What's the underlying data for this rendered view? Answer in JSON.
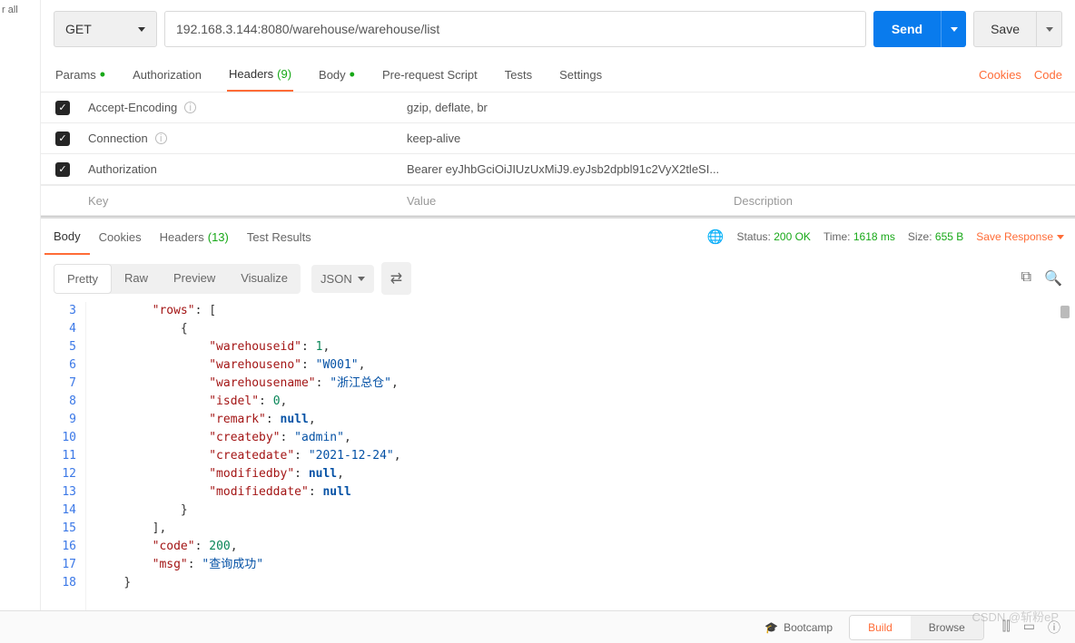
{
  "leftStrip": "r all",
  "request": {
    "method": "GET",
    "url": "192.168.3.144:8080/warehouse/warehouse/list",
    "sendLabel": "Send",
    "saveLabel": "Save"
  },
  "reqTabs": {
    "params": "Params",
    "authorization": "Authorization",
    "headers": "Headers",
    "headersCount": "(9)",
    "body": "Body",
    "preRequest": "Pre-request Script",
    "tests": "Tests",
    "settings": "Settings",
    "cookies": "Cookies",
    "code": "Code"
  },
  "headers": [
    {
      "key": "Accept-Encoding",
      "value": "gzip, deflate, br",
      "info": true
    },
    {
      "key": "Connection",
      "value": "keep-alive",
      "info": true
    },
    {
      "key": "Authorization",
      "value": "Bearer eyJhbGciOiJIUzUxMiJ9.eyJsb2dpbl91c2VyX2tleSI...",
      "info": false
    }
  ],
  "headerPlaceholders": {
    "key": "Key",
    "value": "Value",
    "description": "Description"
  },
  "respTabs": {
    "body": "Body",
    "cookies": "Cookies",
    "headers": "Headers",
    "headersCount": "(13)",
    "testResults": "Test Results"
  },
  "respMeta": {
    "statusLabel": "Status:",
    "statusValue": "200 OK",
    "timeLabel": "Time:",
    "timeValue": "1618 ms",
    "sizeLabel": "Size:",
    "sizeValue": "655 B",
    "saveResponse": "Save Response"
  },
  "formatBar": {
    "pretty": "Pretty",
    "raw": "Raw",
    "preview": "Preview",
    "visualize": "Visualize",
    "json": "JSON"
  },
  "codeLines": [
    {
      "num": "3",
      "indent": 2,
      "parts": [
        {
          "t": "key",
          "v": "\"rows\""
        },
        {
          "t": "punc",
          "v": ": ["
        }
      ]
    },
    {
      "num": "4",
      "indent": 3,
      "parts": [
        {
          "t": "punc",
          "v": "{"
        }
      ]
    },
    {
      "num": "5",
      "indent": 4,
      "parts": [
        {
          "t": "key",
          "v": "\"warehouseid\""
        },
        {
          "t": "punc",
          "v": ": "
        },
        {
          "t": "num",
          "v": "1"
        },
        {
          "t": "punc",
          "v": ","
        }
      ]
    },
    {
      "num": "6",
      "indent": 4,
      "parts": [
        {
          "t": "key",
          "v": "\"warehouseno\""
        },
        {
          "t": "punc",
          "v": ": "
        },
        {
          "t": "str",
          "v": "\"W001\""
        },
        {
          "t": "punc",
          "v": ","
        }
      ]
    },
    {
      "num": "7",
      "indent": 4,
      "parts": [
        {
          "t": "key",
          "v": "\"warehousename\""
        },
        {
          "t": "punc",
          "v": ": "
        },
        {
          "t": "str",
          "v": "\"浙江总仓\""
        },
        {
          "t": "punc",
          "v": ","
        }
      ]
    },
    {
      "num": "8",
      "indent": 4,
      "parts": [
        {
          "t": "key",
          "v": "\"isdel\""
        },
        {
          "t": "punc",
          "v": ": "
        },
        {
          "t": "num",
          "v": "0"
        },
        {
          "t": "punc",
          "v": ","
        }
      ]
    },
    {
      "num": "9",
      "indent": 4,
      "parts": [
        {
          "t": "key",
          "v": "\"remark\""
        },
        {
          "t": "punc",
          "v": ": "
        },
        {
          "t": "null",
          "v": "null"
        },
        {
          "t": "punc",
          "v": ","
        }
      ]
    },
    {
      "num": "10",
      "indent": 4,
      "parts": [
        {
          "t": "key",
          "v": "\"createby\""
        },
        {
          "t": "punc",
          "v": ": "
        },
        {
          "t": "str",
          "v": "\"admin\""
        },
        {
          "t": "punc",
          "v": ","
        }
      ]
    },
    {
      "num": "11",
      "indent": 4,
      "parts": [
        {
          "t": "key",
          "v": "\"createdate\""
        },
        {
          "t": "punc",
          "v": ": "
        },
        {
          "t": "str",
          "v": "\"2021-12-24\""
        },
        {
          "t": "punc",
          "v": ","
        }
      ]
    },
    {
      "num": "12",
      "indent": 4,
      "parts": [
        {
          "t": "key",
          "v": "\"modifiedby\""
        },
        {
          "t": "punc",
          "v": ": "
        },
        {
          "t": "null",
          "v": "null"
        },
        {
          "t": "punc",
          "v": ","
        }
      ]
    },
    {
      "num": "13",
      "indent": 4,
      "parts": [
        {
          "t": "key",
          "v": "\"modifieddate\""
        },
        {
          "t": "punc",
          "v": ": "
        },
        {
          "t": "null",
          "v": "null"
        }
      ]
    },
    {
      "num": "14",
      "indent": 3,
      "parts": [
        {
          "t": "punc",
          "v": "}"
        }
      ]
    },
    {
      "num": "15",
      "indent": 2,
      "parts": [
        {
          "t": "punc",
          "v": "],"
        }
      ]
    },
    {
      "num": "16",
      "indent": 2,
      "parts": [
        {
          "t": "key",
          "v": "\"code\""
        },
        {
          "t": "punc",
          "v": ": "
        },
        {
          "t": "num",
          "v": "200"
        },
        {
          "t": "punc",
          "v": ","
        }
      ]
    },
    {
      "num": "17",
      "indent": 2,
      "parts": [
        {
          "t": "key",
          "v": "\"msg\""
        },
        {
          "t": "punc",
          "v": ": "
        },
        {
          "t": "str",
          "v": "\"查询成功\""
        }
      ]
    },
    {
      "num": "18",
      "indent": 1,
      "parts": [
        {
          "t": "punc",
          "v": "}"
        }
      ]
    }
  ],
  "bottomBar": {
    "bootcamp": "Bootcamp",
    "build": "Build",
    "browse": "Browse"
  },
  "watermark": "CSDN @斩粉eP"
}
